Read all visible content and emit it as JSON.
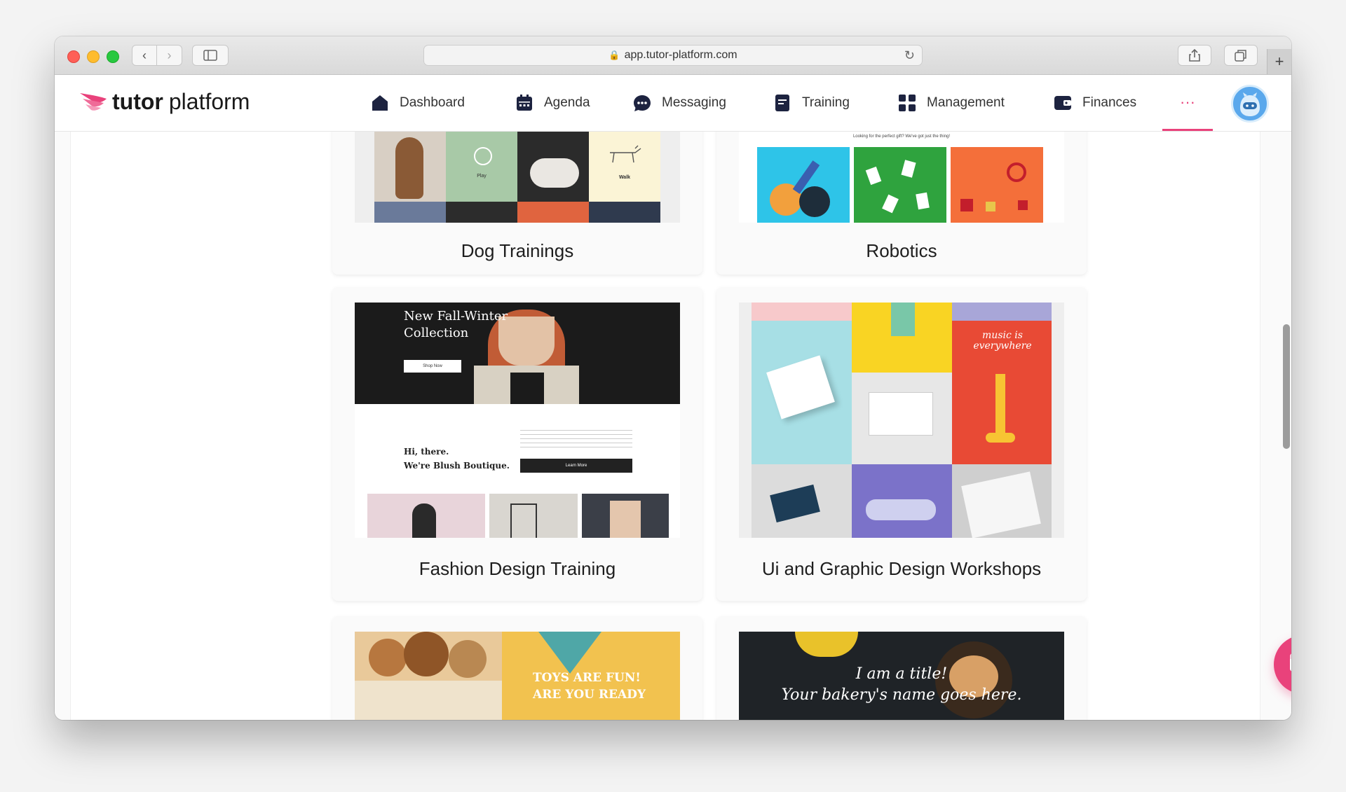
{
  "browser": {
    "url": "app.tutor-platform.com"
  },
  "app": {
    "logo_bold": "tutor",
    "logo_light": "platform",
    "brand_color": "#e9427b"
  },
  "nav": {
    "items": [
      {
        "label": "Dashboard",
        "icon": "home-icon"
      },
      {
        "label": "Agenda",
        "icon": "calendar-icon"
      },
      {
        "label": "Messaging",
        "icon": "chat-bubble-icon"
      },
      {
        "label": "Training",
        "icon": "document-icon"
      },
      {
        "label": "Management",
        "icon": "grid-icon"
      },
      {
        "label": "Finances",
        "icon": "wallet-icon"
      }
    ],
    "more_label": "···"
  },
  "courses": [
    {
      "title": "Dog Trainings"
    },
    {
      "title": "Robotics"
    },
    {
      "title": "Fashion Design Training",
      "thumb_heading": "New Fall-Winter Collection",
      "thumb_button": "Shop Now",
      "thumb_greeting_1": "Hi, there.",
      "thumb_greeting_2": "We're Blush Boutique.",
      "thumb_cta": "Learn More"
    },
    {
      "title": "Ui and Graphic Design Workshops",
      "thumb_music": "music is everywhere"
    },
    {
      "title": "",
      "thumb_line_1": "TOYS ARE FUN!",
      "thumb_line_2": "ARE YOU READY"
    },
    {
      "title": "",
      "thumb_line_1": "I am a title!",
      "thumb_line_2": "Your bakery's name goes here."
    }
  ],
  "robotics_tagline": "Looking for the perfect gift? We've got just the thing!",
  "dog_thumb_labels": [
    "Play",
    "Walk"
  ]
}
